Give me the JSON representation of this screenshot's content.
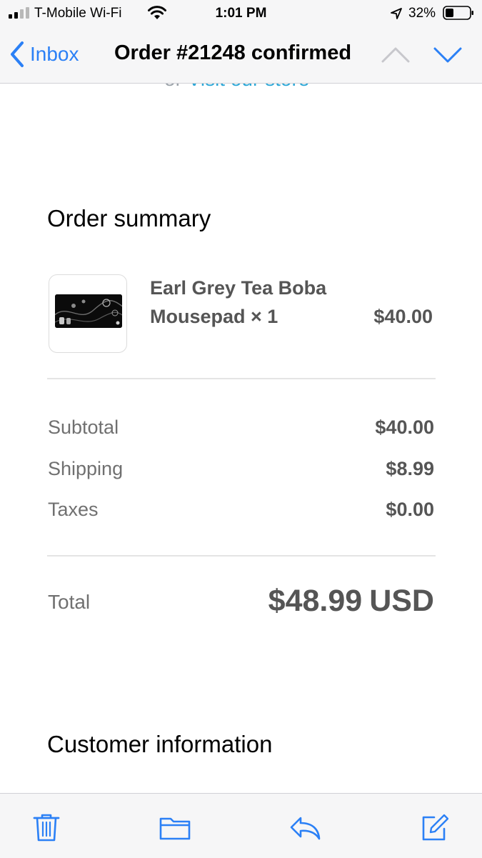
{
  "status_bar": {
    "carrier": "T-Mobile Wi-Fi",
    "time": "1:01 PM",
    "battery_percent": "32%"
  },
  "nav": {
    "back_label": "Inbox",
    "title": "Order #21248 confirmed"
  },
  "email": {
    "cut_prefix": "or ",
    "cut_link": "Visit our store",
    "order_summary_heading": "Order summary",
    "product": {
      "name_line1": "Earl Grey Tea Boba",
      "name_line2": "Mousepad × 1",
      "price": "$40.00"
    },
    "totals": {
      "subtotal_label": "Subtotal",
      "subtotal_value": "$40.00",
      "shipping_label": "Shipping",
      "shipping_value": "$8.99",
      "taxes_label": "Taxes",
      "taxes_value": "$0.00",
      "total_label": "Total",
      "total_amount": "$48.99",
      "total_currency": "USD"
    },
    "customer_info_heading": "Customer information"
  },
  "colors": {
    "accent": "#2b80f6",
    "link": "#2ba6d6",
    "bar_background": "#f6f6f7",
    "muted_text": "#707070"
  },
  "icons": [
    "signal-icon",
    "wifi-icon",
    "location-arrow-icon",
    "battery-icon",
    "chevron-left-icon",
    "chevron-up-icon",
    "chevron-down-icon",
    "trash-icon",
    "folder-icon",
    "reply-icon",
    "compose-icon"
  ]
}
